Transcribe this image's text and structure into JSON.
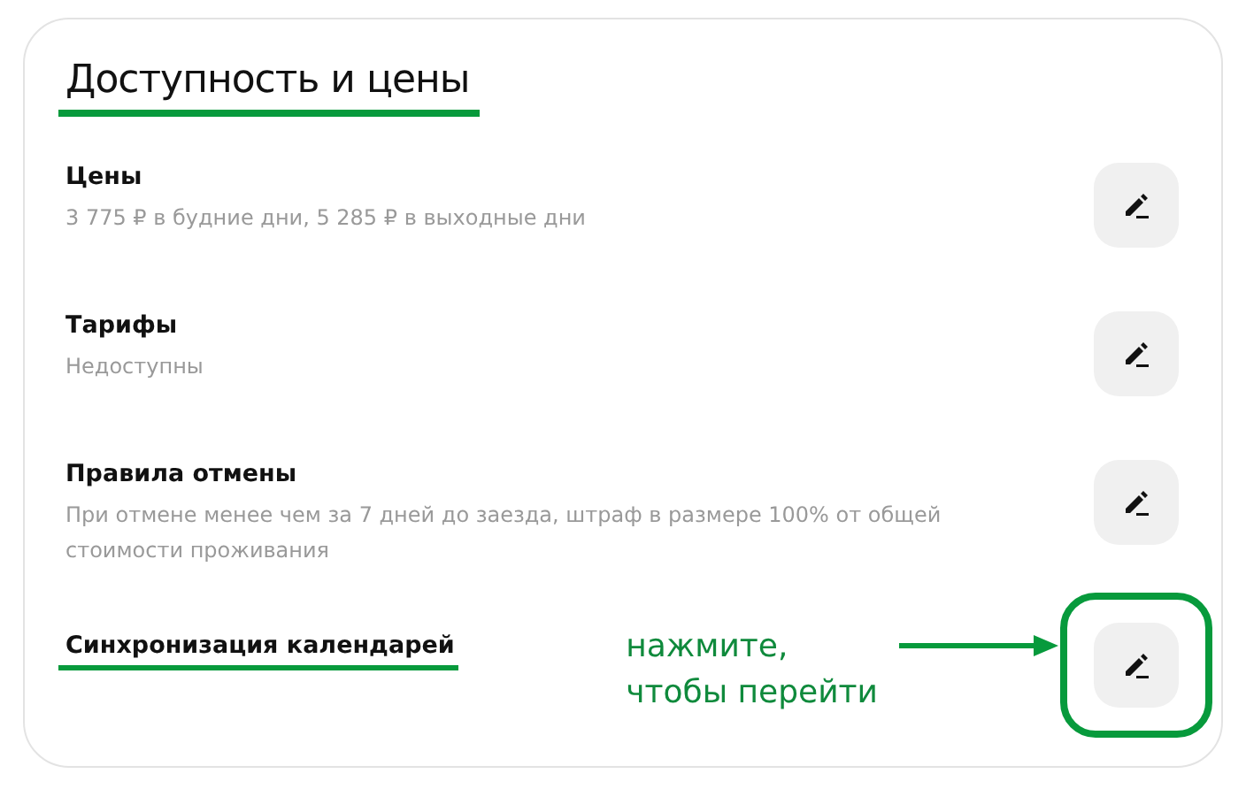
{
  "heading": {
    "text": "Доступность и цены",
    "underlined": true
  },
  "rows": [
    {
      "title": "Цены",
      "subtitle": "3 775 ₽ в будние дни, 5 285 ₽ в выходные дни",
      "underlined": false,
      "highlighted": false
    },
    {
      "title": "Тарифы",
      "subtitle": "Недоступны",
      "underlined": false,
      "highlighted": false
    },
    {
      "title": "Правила отмены",
      "subtitle": "При отмене менее чем за 7 дней до заезда, штраф в размере 100% от общей стоимости проживания",
      "underlined": false,
      "highlighted": false
    },
    {
      "title": "Синхронизация календарей",
      "underlined": true,
      "highlighted": true,
      "callout": [
        "нажмите,",
        "чтобы перейти"
      ]
    }
  ]
}
